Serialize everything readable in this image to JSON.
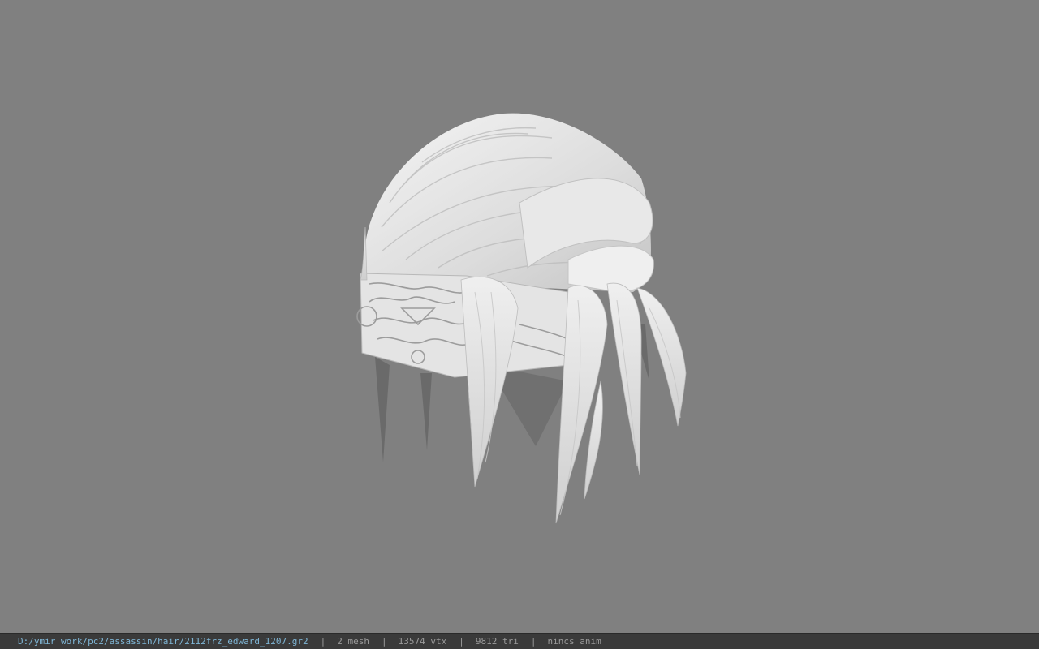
{
  "viewport": {
    "background": "#808080",
    "model_color": "#e6e6e6"
  },
  "statusbar": {
    "file_path": "D:/ymir work/pc2/assassin/hair/2112frz_edward_1207.gr2",
    "separator": "|",
    "mesh_count": "2 mesh",
    "vertex_count": "13574 vtx",
    "triangle_count": "9812 tri",
    "anim_status": "nincs anim",
    "path_color": "#7fb6d6",
    "text_color": "#9a9a9a"
  }
}
